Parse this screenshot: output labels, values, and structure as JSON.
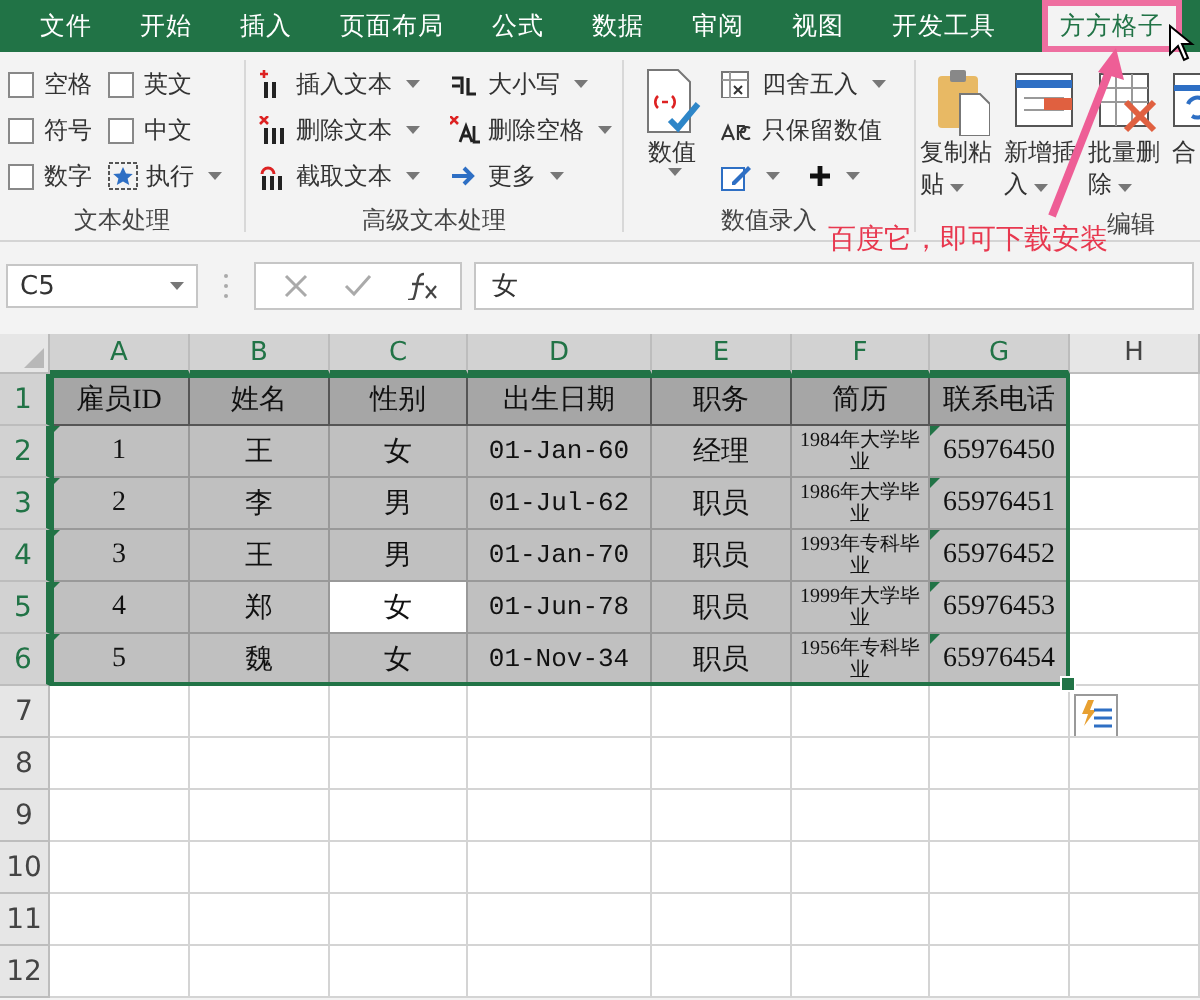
{
  "ribbon_tabs": [
    {
      "label": "文件",
      "selected": false
    },
    {
      "label": "开始",
      "selected": false
    },
    {
      "label": "插入",
      "selected": false
    },
    {
      "label": "页面布局",
      "selected": false
    },
    {
      "label": "公式",
      "selected": false
    },
    {
      "label": "数据",
      "selected": false
    },
    {
      "label": "审阅",
      "selected": false
    },
    {
      "label": "视图",
      "selected": false
    },
    {
      "label": "开发工具",
      "selected": false
    },
    {
      "label": "方方格子",
      "selected": true
    }
  ],
  "text_group": {
    "title": "文本处理",
    "checkboxes": [
      {
        "label": "空格",
        "checked": false
      },
      {
        "label": "英文",
        "checked": false
      },
      {
        "label": "符号",
        "checked": false
      },
      {
        "label": "中文",
        "checked": false
      },
      {
        "label": "数字",
        "checked": false
      }
    ],
    "run_button": {
      "label": "执行",
      "dropdown": true
    }
  },
  "advanced_group": {
    "title": "高级文本处理",
    "buttons": [
      {
        "label": "插入文本",
        "dropdown": true
      },
      {
        "label": "大小写",
        "dropdown": true
      },
      {
        "label": "删除文本",
        "dropdown": true
      },
      {
        "label": "删除空格",
        "dropdown": true
      },
      {
        "label": "截取文本",
        "dropdown": true
      },
      {
        "label": "更多",
        "dropdown": true
      }
    ]
  },
  "number_group": {
    "title": "数值录入",
    "big_button": {
      "label": "数值",
      "dropdown": true
    },
    "buttons": [
      {
        "kind": "text",
        "label": "四舍五入",
        "dropdown": true
      },
      {
        "kind": "text",
        "label": "只保留数值",
        "dropdown": false
      },
      {
        "kind": "icon",
        "dropdown": true
      },
      {
        "kind": "icon",
        "dropdown": true
      }
    ]
  },
  "edit_group": {
    "title": "编辑",
    "buttons": [
      {
        "label": "复制粘贴",
        "dropdown": true
      },
      {
        "label": "新增插入",
        "dropdown": true
      },
      {
        "label": "批量删除",
        "dropdown": true
      },
      {
        "label": "合",
        "dropdown": false
      }
    ]
  },
  "annotation": {
    "text": "百度它，即可下载安装"
  },
  "name_box": "C5",
  "formula": "女",
  "grid": {
    "columns": [
      {
        "label": "A",
        "highlighted": true
      },
      {
        "label": "B",
        "highlighted": true
      },
      {
        "label": "C",
        "highlighted": true
      },
      {
        "label": "D",
        "highlighted": true
      },
      {
        "label": "E",
        "highlighted": true
      },
      {
        "label": "F",
        "highlighted": true
      },
      {
        "label": "G",
        "highlighted": true
      },
      {
        "label": "H",
        "highlighted": false
      }
    ],
    "rows": [
      {
        "header": "1",
        "highlighted": true,
        "kind": "title",
        "cells": [
          {
            "text": "雇员ID",
            "selected": false,
            "flagged": false
          },
          {
            "text": "姓名",
            "selected": false,
            "flagged": false
          },
          {
            "text": "性别",
            "selected": false,
            "flagged": false
          },
          {
            "text": "出生日期",
            "selected": false,
            "flagged": false
          },
          {
            "text": "职务",
            "selected": false,
            "flagged": false
          },
          {
            "text": "简历",
            "selected": false,
            "flagged": false
          },
          {
            "text": "联系电话",
            "selected": false,
            "flagged": false
          }
        ]
      },
      {
        "header": "2",
        "highlighted": true,
        "kind": "data",
        "cells": [
          {
            "text": "1",
            "selected": false,
            "flagged": true
          },
          {
            "text": "王",
            "selected": false,
            "flagged": false
          },
          {
            "text": "女",
            "selected": false,
            "flagged": false
          },
          {
            "text": "01-Jan-60",
            "selected": false,
            "flagged": false
          },
          {
            "text": "经理",
            "selected": false,
            "flagged": false
          },
          {
            "text": "1984年大学毕业",
            "selected": false,
            "flagged": false
          },
          {
            "text": "65976450",
            "selected": false,
            "flagged": true
          }
        ]
      },
      {
        "header": "3",
        "highlighted": true,
        "kind": "data",
        "cells": [
          {
            "text": "2",
            "selected": false,
            "flagged": true
          },
          {
            "text": "李",
            "selected": false,
            "flagged": false
          },
          {
            "text": "男",
            "selected": false,
            "flagged": false
          },
          {
            "text": "01-Jul-62",
            "selected": false,
            "flagged": false
          },
          {
            "text": "职员",
            "selected": false,
            "flagged": false
          },
          {
            "text": "1986年大学毕业",
            "selected": false,
            "flagged": false
          },
          {
            "text": "65976451",
            "selected": false,
            "flagged": true
          }
        ]
      },
      {
        "header": "4",
        "highlighted": true,
        "kind": "data",
        "cells": [
          {
            "text": "3",
            "selected": false,
            "flagged": true
          },
          {
            "text": "王",
            "selected": false,
            "flagged": false
          },
          {
            "text": "男",
            "selected": false,
            "flagged": false
          },
          {
            "text": "01-Jan-70",
            "selected": false,
            "flagged": false
          },
          {
            "text": "职员",
            "selected": false,
            "flagged": false
          },
          {
            "text": "1993年专科毕业",
            "selected": false,
            "flagged": false
          },
          {
            "text": "65976452",
            "selected": false,
            "flagged": true
          }
        ]
      },
      {
        "header": "5",
        "highlighted": true,
        "kind": "data",
        "cells": [
          {
            "text": "4",
            "selected": false,
            "flagged": true
          },
          {
            "text": "郑",
            "selected": false,
            "flagged": false
          },
          {
            "text": "女",
            "selected": true,
            "flagged": false
          },
          {
            "text": "01-Jun-78",
            "selected": false,
            "flagged": false
          },
          {
            "text": "职员",
            "selected": false,
            "flagged": false
          },
          {
            "text": "1999年大学毕业",
            "selected": false,
            "flagged": false
          },
          {
            "text": "65976453",
            "selected": false,
            "flagged": true
          }
        ]
      },
      {
        "header": "6",
        "highlighted": true,
        "kind": "data",
        "cells": [
          {
            "text": "5",
            "selected": false,
            "flagged": true
          },
          {
            "text": "魏",
            "selected": false,
            "flagged": false
          },
          {
            "text": "女",
            "selected": false,
            "flagged": false
          },
          {
            "text": "01-Nov-34",
            "selected": false,
            "flagged": false
          },
          {
            "text": "职员",
            "selected": false,
            "flagged": false
          },
          {
            "text": "1956年专科毕业",
            "selected": false,
            "flagged": false
          },
          {
            "text": "65976454",
            "selected": false,
            "flagged": true
          }
        ]
      },
      {
        "header": "7",
        "highlighted": false,
        "kind": "empty"
      },
      {
        "header": "8",
        "highlighted": false,
        "kind": "empty"
      },
      {
        "header": "9",
        "highlighted": false,
        "kind": "empty"
      },
      {
        "header": "10",
        "highlighted": false,
        "kind": "empty"
      },
      {
        "header": "11",
        "highlighted": false,
        "kind": "empty"
      },
      {
        "header": "12",
        "highlighted": false,
        "kind": "empty"
      }
    ]
  }
}
